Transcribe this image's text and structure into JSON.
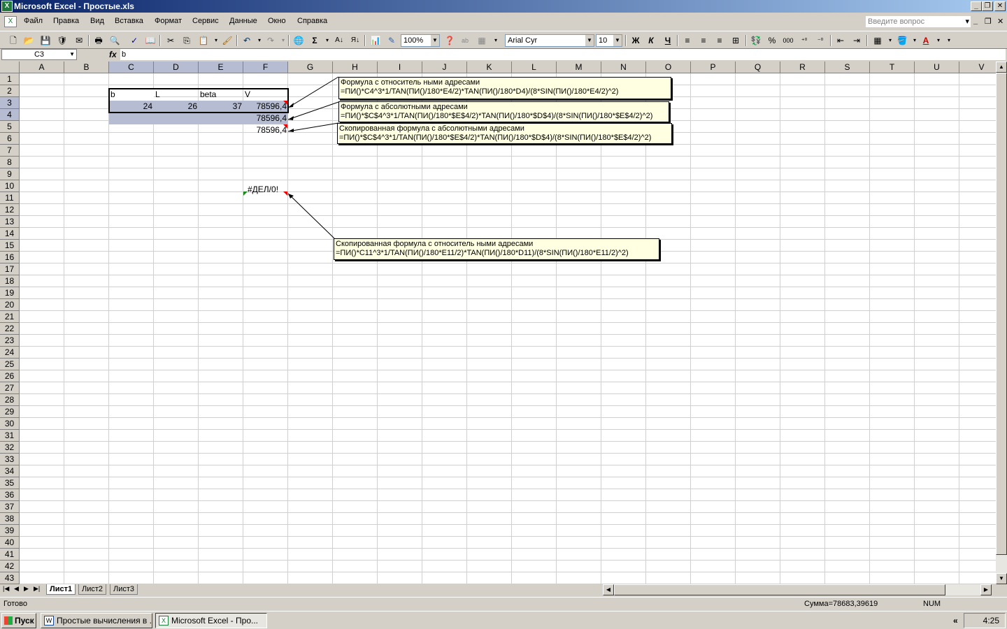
{
  "window": {
    "title": "Microsoft Excel - Простые.xls",
    "app_icon": "excel-icon"
  },
  "menu": [
    "Файл",
    "Правка",
    "Вид",
    "Вставка",
    "Формат",
    "Сервис",
    "Данные",
    "Окно",
    "Справка"
  ],
  "help": {
    "placeholder": "Введите вопрос"
  },
  "toolbar": {
    "zoom": "100%",
    "font": "Arial Cyr",
    "font_size": "10",
    "bold": "Ж",
    "italic": "К",
    "underline": "Ч",
    "sigma": "Σ",
    "percent": "%",
    "thousands": "000"
  },
  "formula_bar": {
    "name_box": "C3",
    "fx": "fx",
    "value": "b"
  },
  "columns": [
    "A",
    "B",
    "C",
    "D",
    "E",
    "F",
    "G",
    "H",
    "I",
    "J",
    "K",
    "L",
    "M",
    "N",
    "O",
    "P",
    "Q",
    "R",
    "S",
    "T",
    "U",
    "V"
  ],
  "rows": [
    "1",
    "2",
    "3",
    "4",
    "5",
    "6",
    "7",
    "8",
    "9",
    "10",
    "11",
    "12",
    "13",
    "14",
    "15",
    "16",
    "17",
    "18",
    "19",
    "20",
    "21",
    "22",
    "23",
    "24",
    "25",
    "26",
    "27",
    "28",
    "29",
    "30",
    "31",
    "32",
    "33",
    "34",
    "35",
    "36",
    "37",
    "38",
    "39",
    "40",
    "41",
    "42",
    "43"
  ],
  "cells": {
    "C3": "b",
    "D3": "L",
    "E3": "beta",
    "F3": "V",
    "C4": "24",
    "D4": "26",
    "E4": "37",
    "F4": "78596,4",
    "F5": "78596,4",
    "F6": "78596,4",
    "F11": "#ДЕЛ/0!"
  },
  "comments": [
    {
      "line1": "Формула с относитель ными адресами",
      "line2": "=ПИ()*C4^3*1/TAN(ПИ()/180*E4/2)*TAN(ПИ()/180*D4)/(8*SIN(ПИ()/180*E4/2)^2)"
    },
    {
      "line1": "Формула с абсолютными адресами",
      "line2": "=ПИ()*$C$4^3*1/TAN(ПИ()/180*$E$4/2)*TAN(ПИ()/180*$D$4)/(8*SIN(ПИ()/180*$E$4/2)^2)"
    },
    {
      "line1": "Скопированная формула с абсолютными адресами",
      "line2": "=ПИ()*$C$4^3*1/TAN(ПИ()/180*$E$4/2)*TAN(ПИ()/180*$D$4)/(8*SIN(ПИ()/180*$E$4/2)^2)"
    },
    {
      "line1": "Скопированная формула с относитель ными адресами",
      "line2": "=ПИ()*C11^3*1/TAN(ПИ()/180*E11/2)*TAN(ПИ()/180*D11)/(8*SIN(ПИ()/180*E11/2)^2)"
    }
  ],
  "sheets": [
    "Лист1",
    "Лист2",
    "Лист3"
  ],
  "status": {
    "ready": "Готово",
    "sum": "Сумма=78683,39619",
    "num": "NUM"
  },
  "taskbar": {
    "start": "Пуск",
    "tasks": [
      "Простые вычисления в ...",
      "Microsoft Excel - Про..."
    ],
    "tray_chevron": "«",
    "clock": "4:25"
  }
}
